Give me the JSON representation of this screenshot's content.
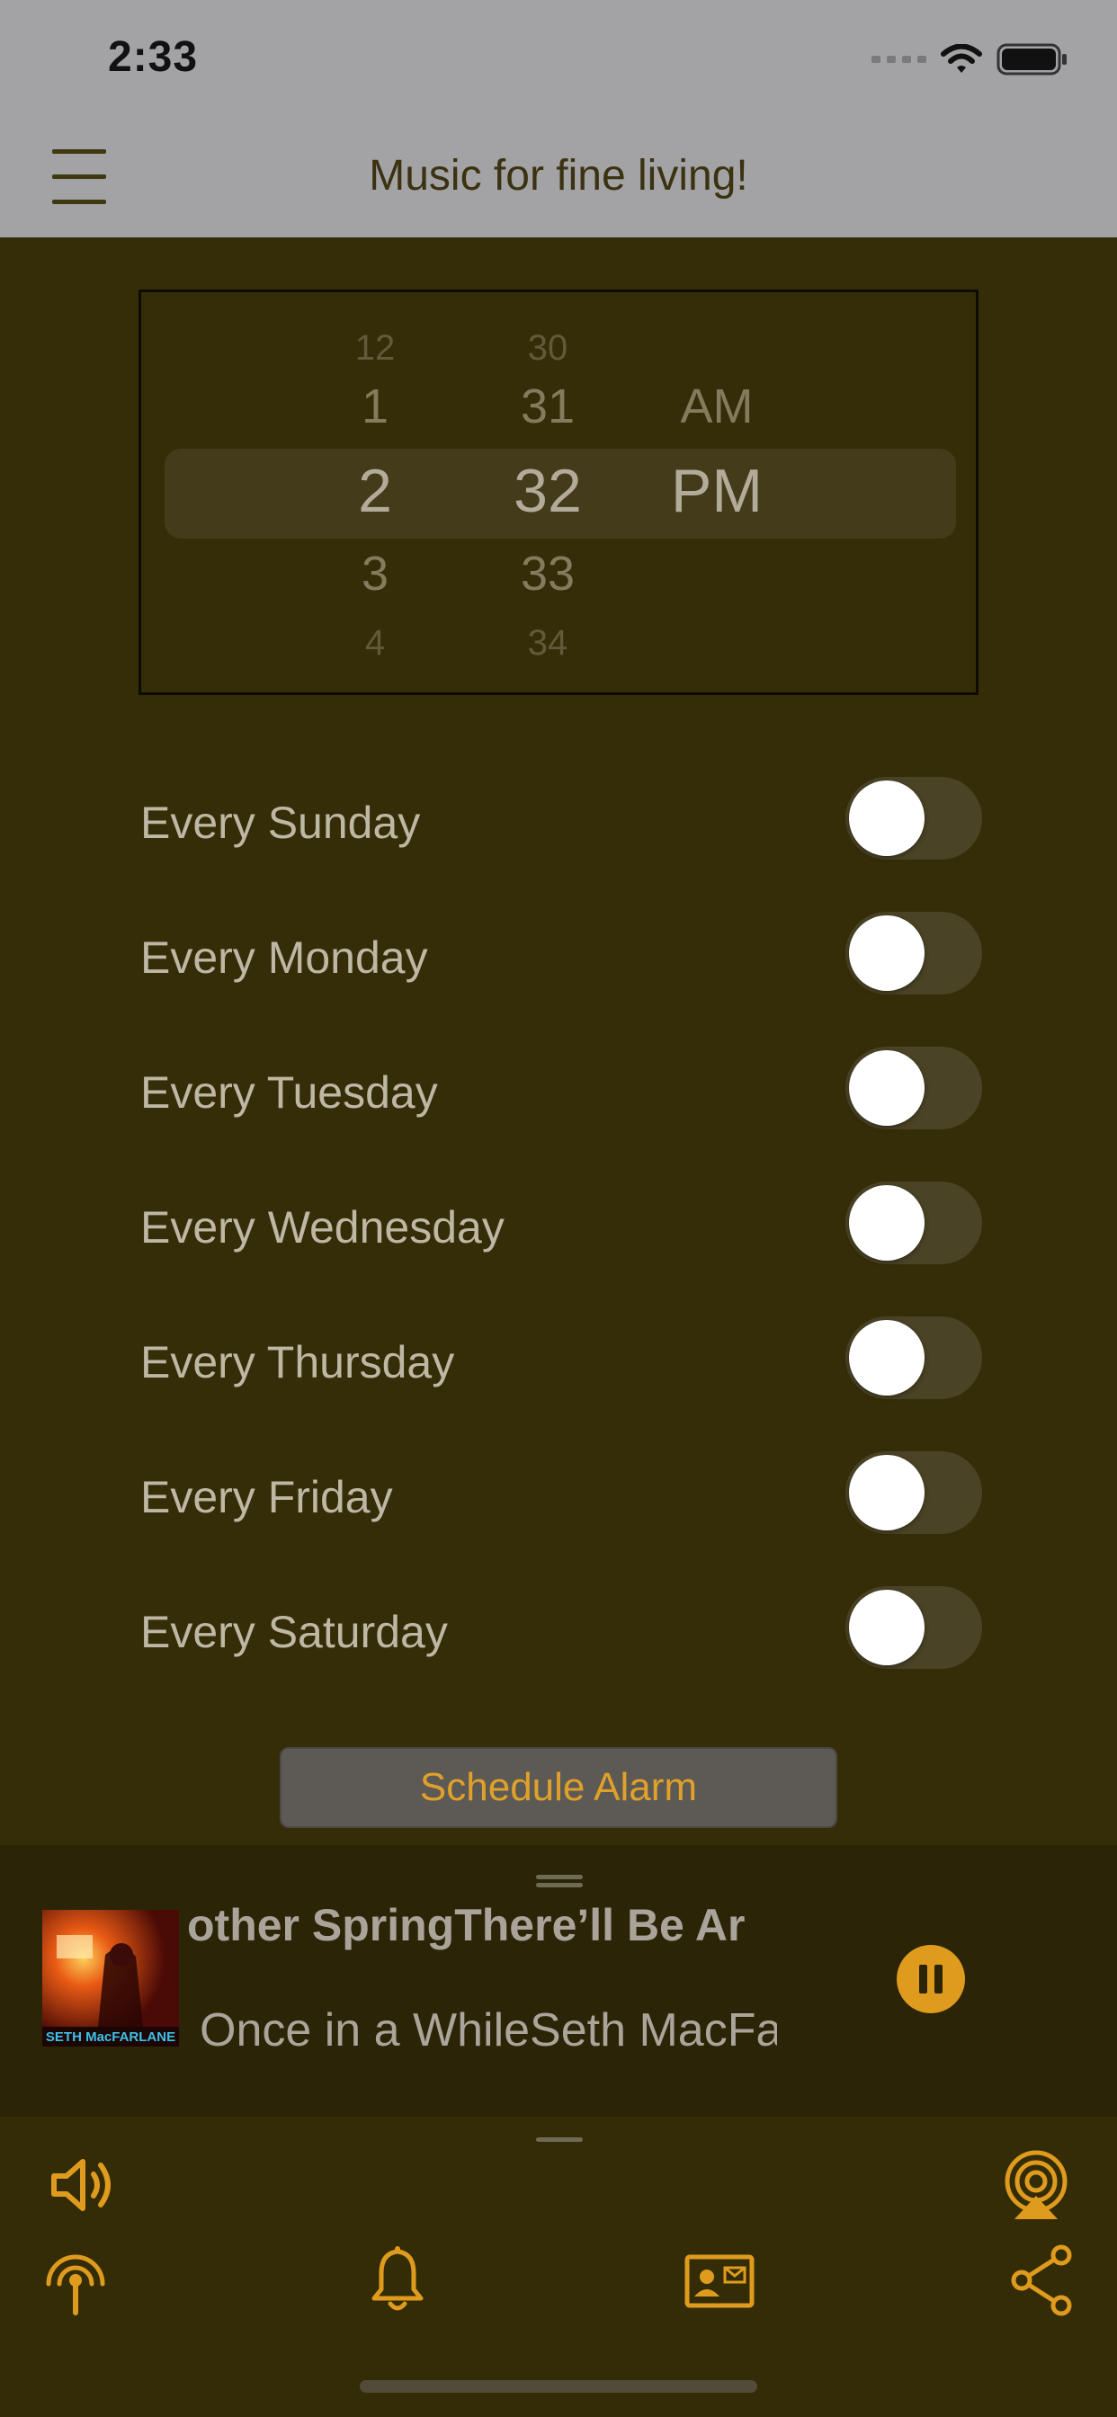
{
  "status_bar": {
    "time": "2:33"
  },
  "header": {
    "title": "Music for fine living!"
  },
  "time_picker": {
    "hours": [
      "12",
      "1",
      "2",
      "3",
      "4"
    ],
    "minutes": [
      "30",
      "31",
      "32",
      "33",
      "34"
    ],
    "periods": [
      "AM",
      "PM"
    ],
    "selected": {
      "hour": "2",
      "minute": "32",
      "period": "PM"
    }
  },
  "days": [
    {
      "label": "Every Sunday",
      "enabled": false
    },
    {
      "label": "Every Monday",
      "enabled": false
    },
    {
      "label": "Every Tuesday",
      "enabled": false
    },
    {
      "label": "Every Wednesday",
      "enabled": false
    },
    {
      "label": "Every Thursday",
      "enabled": false
    },
    {
      "label": "Every Friday",
      "enabled": false
    },
    {
      "label": "Every Saturday",
      "enabled": false
    }
  ],
  "schedule_button": {
    "label": "Schedule Alarm"
  },
  "now_playing": {
    "title_line": "other SpringThere’ll Be Ar",
    "subtitle_line": "Once in a WhileSeth MacFa",
    "album_art_text": "SETH MacFARLANE",
    "play_state": "playing"
  },
  "toolbar_icons": [
    "volume-icon",
    "airplay-icon",
    "broadcast-icon",
    "bell-icon",
    "contact-card-icon",
    "share-icon"
  ],
  "colors": {
    "background": "#352d08",
    "header_background": "#a3a3a5",
    "accent": "#df9b1d",
    "toggle_off": "#4a4326",
    "now_playing_background": "#2b2406"
  }
}
